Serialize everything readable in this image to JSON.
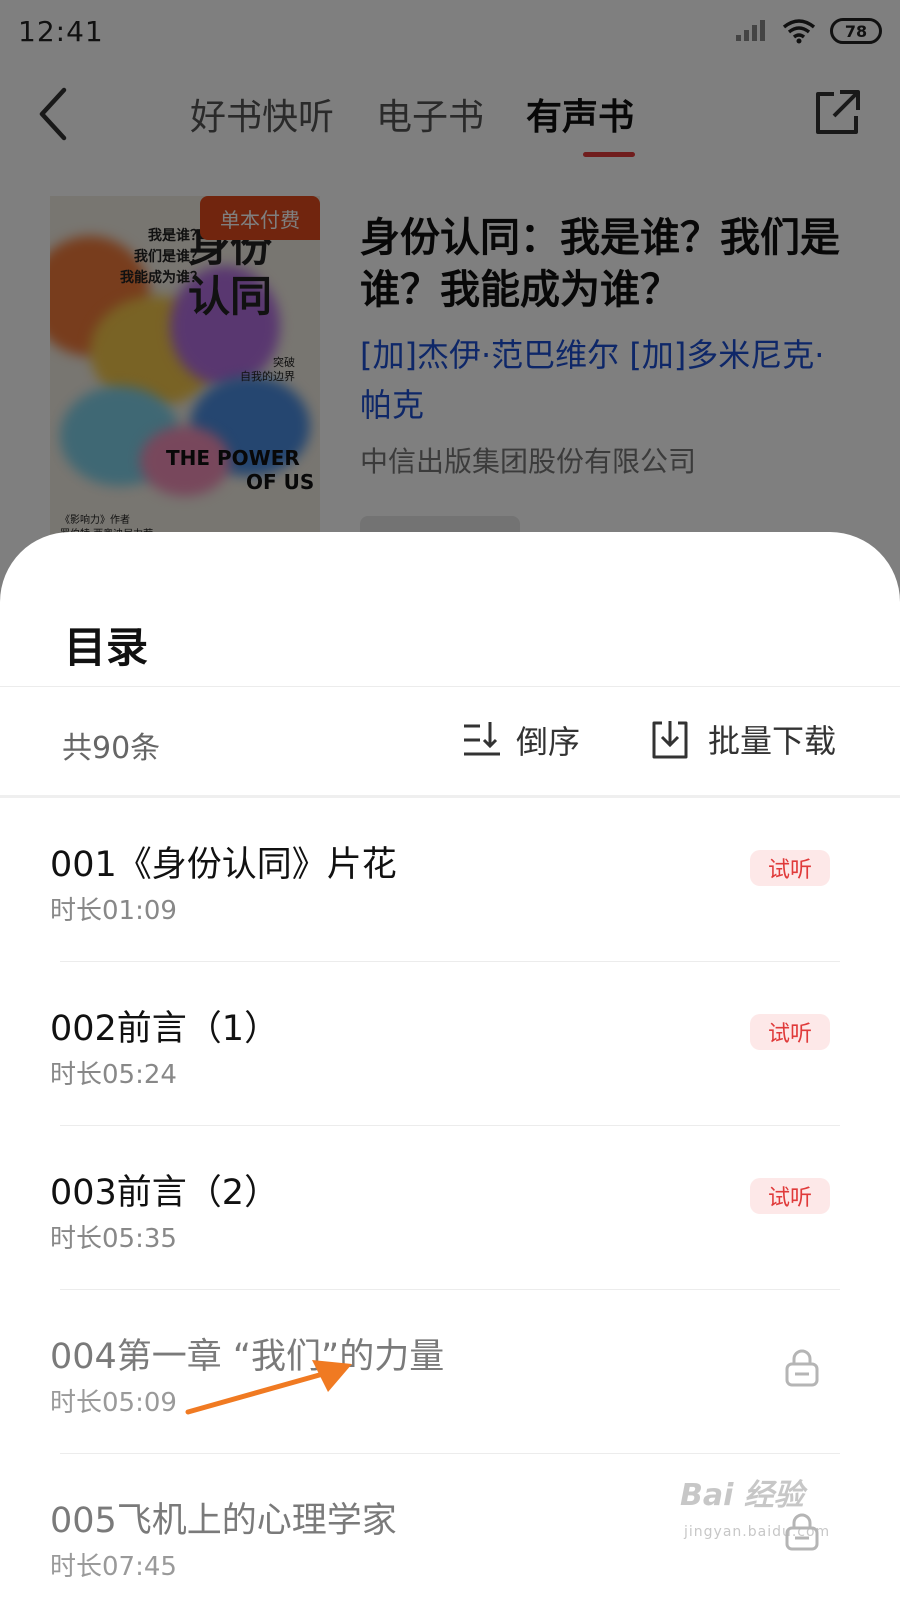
{
  "status_bar": {
    "time": "12:41",
    "battery": "78",
    "signal_icon": "signal-icon",
    "wifi_icon": "wifi-icon"
  },
  "nav": {
    "back_icon": "chevron-left-icon",
    "tabs": [
      {
        "label": "好书快听",
        "active": false
      },
      {
        "label": "电子书",
        "active": false
      },
      {
        "label": "有声书",
        "active": true
      }
    ],
    "share_icon": "share-icon",
    "accent_color": "#e03a3a"
  },
  "book": {
    "badge": "单本付费",
    "title": "身份认同：我是谁？我们是谁？我能成为谁？",
    "authors": "[加]杰伊·范巴维尔 [加]多米尼克·帕克",
    "publisher": "中信出版集团股份有限公司",
    "cover": {
      "questions": "我是谁？\n我们是谁？\n我能成为谁？",
      "title": "身份\n认同",
      "subtitle": "突破\n自我的边界",
      "english_line1": "THE POWER",
      "english_line2": "OF US",
      "credit": "《影响力》作者\n罗伯特·西奥迪尼力荐"
    }
  },
  "sheet": {
    "title": "目录",
    "count": "共90条",
    "sort_label": "倒序",
    "sort_icon": "sort-icon",
    "download_label": "批量下载",
    "download_icon": "download-icon"
  },
  "chapters": [
    {
      "title": "001《身份认同》片花",
      "duration": "时长01:09",
      "badge": "试听",
      "locked": false
    },
    {
      "title": "002前言（1）",
      "duration": "时长05:24",
      "badge": "试听",
      "locked": false
    },
    {
      "title": "003前言（2）",
      "duration": "时长05:35",
      "badge": "试听",
      "locked": false
    },
    {
      "title": "004第一章 “我们”的力量",
      "duration": "时长05:09",
      "badge": "",
      "locked": true
    },
    {
      "title": "005飞机上的心理学家",
      "duration": "时长07:45",
      "badge": "",
      "locked": true
    }
  ],
  "watermark": {
    "text": "Bai 经验",
    "sub": "jingyan.baidu.com"
  },
  "colors": {
    "trial_bg": "#fde8e8",
    "trial_text": "#e03a3a",
    "author_link": "#1d4fd1",
    "badge_bg": "#e24a1c",
    "annotation_arrow": "#f07a22"
  }
}
